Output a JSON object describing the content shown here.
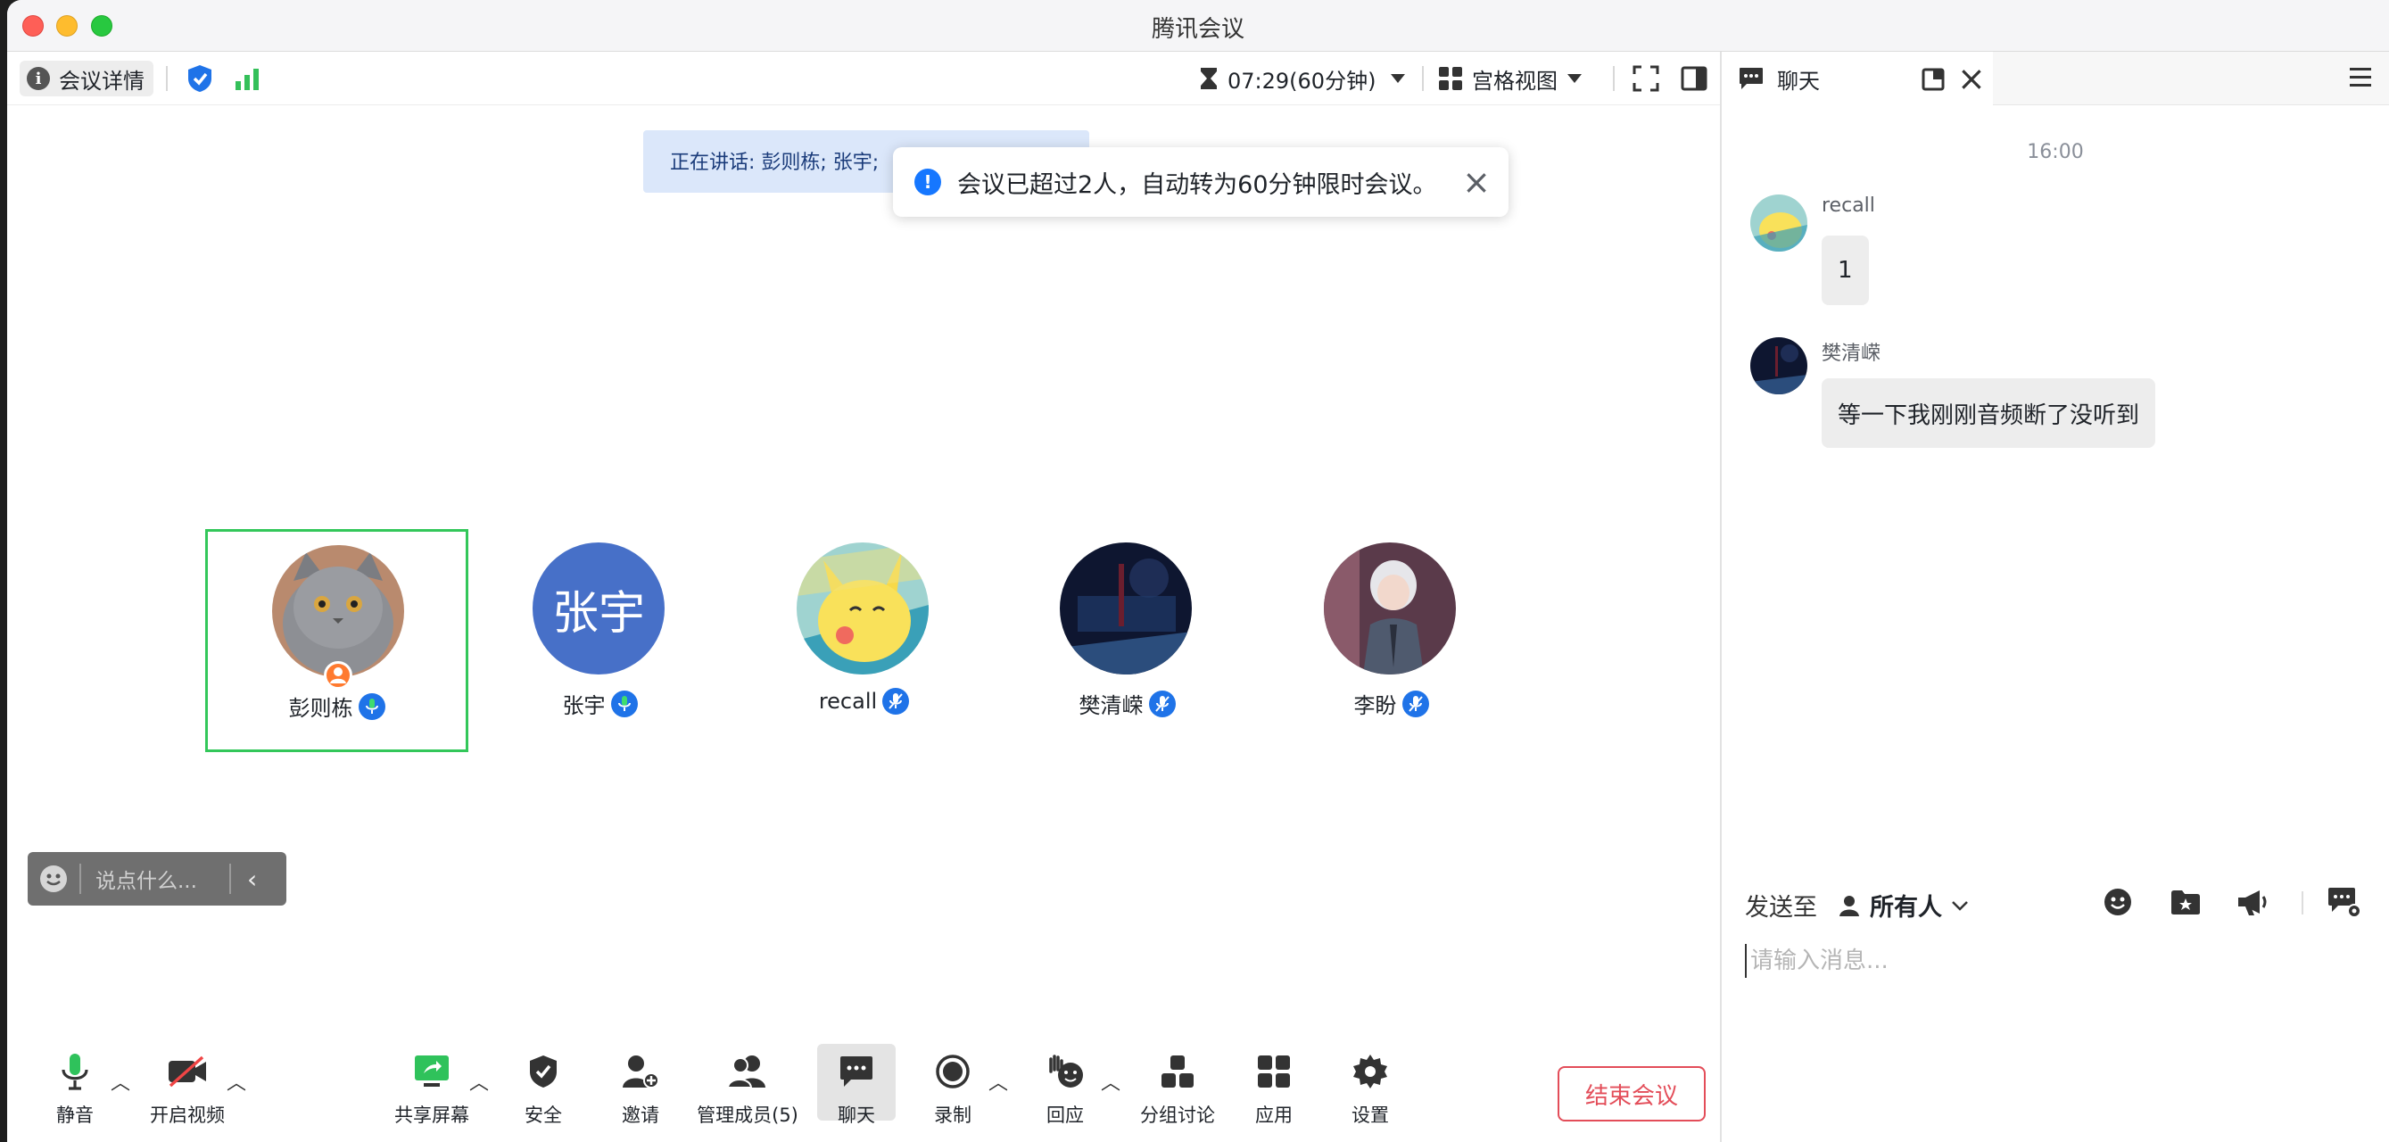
{
  "window": {
    "title": "腾讯会议"
  },
  "topbar": {
    "meeting_details": "会议详情",
    "timer": "07:29(60分钟)",
    "view_mode": "宫格视图"
  },
  "speaking_banner": "正在讲话: 彭则栋; 张宇;",
  "toast": {
    "message": "会议已超过2人，自动转为60分钟限时会议。"
  },
  "participants": [
    {
      "name": "彭则栋",
      "is_host": true,
      "active_speaker": true
    },
    {
      "name": "张宇",
      "avatar_text": "张宇"
    },
    {
      "name": "recall"
    },
    {
      "name": "樊清嵘"
    },
    {
      "name": "李盼"
    }
  ],
  "quick_chat": {
    "placeholder": "说点什么..."
  },
  "toolbar": {
    "mute": "静音",
    "video": "开启视频",
    "share": "共享屏幕",
    "security": "安全",
    "invite": "邀请",
    "members": "管理成员(5)",
    "chat": "聊天",
    "record": "录制",
    "reactions": "回应",
    "breakout": "分组讨论",
    "apps": "应用",
    "settings": "设置",
    "end_meeting": "结束会议"
  },
  "chat": {
    "tab_label": "聊天",
    "time": "16:00",
    "messages": [
      {
        "sender": "recall",
        "text": "1"
      },
      {
        "sender": "樊清嵘",
        "text": "等一下我刚刚音频断了没听到"
      }
    ],
    "send_to_label": "发送至",
    "send_to_target": "所有人",
    "input_placeholder": "请输入消息..."
  },
  "colors": {
    "accent_blue": "#1677ff",
    "active_border": "#33c75a",
    "end_red": "#e34d59",
    "zhangyu_avatar": "#4770c8"
  }
}
